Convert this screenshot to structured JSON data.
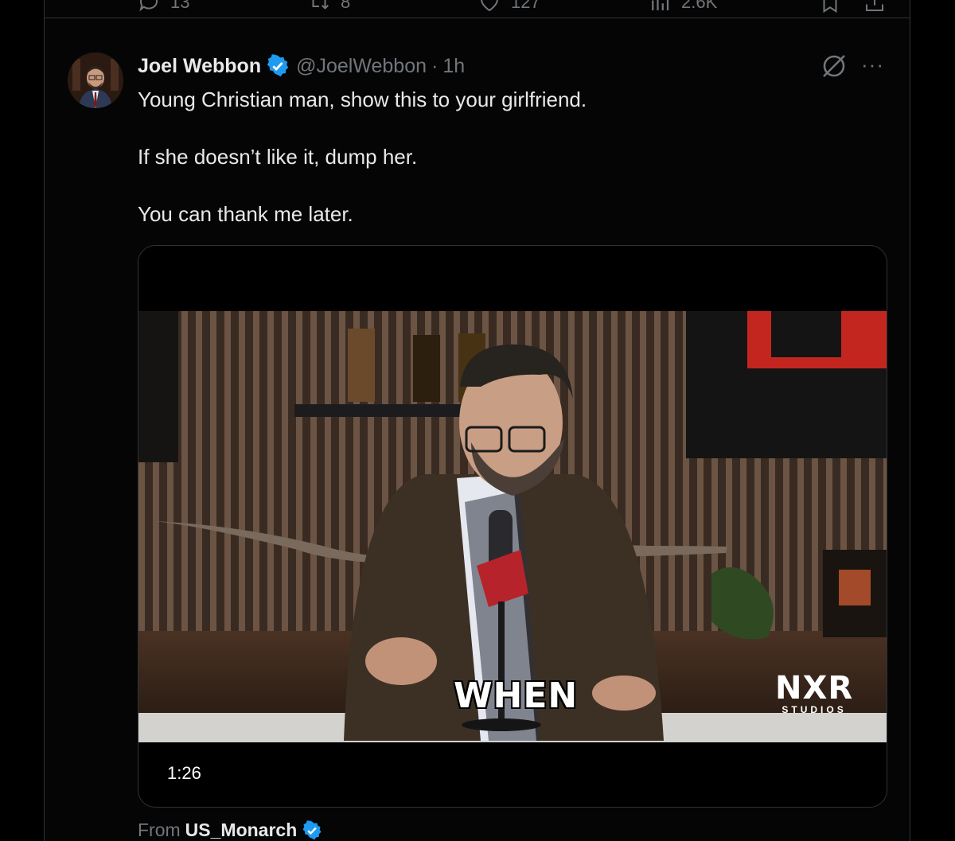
{
  "previous_tweet": {
    "replies": "13",
    "reposts": "8",
    "likes": "127",
    "views": "2.6K"
  },
  "tweet": {
    "author_name": "Joel Webbon",
    "handle": "@JoelWebbon",
    "time_sep": "·",
    "time": "1h",
    "more": "···",
    "lines": [
      "Young Christian man, show this to your girlfriend.",
      "If she doesn’t like it, dump her.",
      "You can thank me later."
    ]
  },
  "media": {
    "duration": "1:26",
    "caption": "WHEN",
    "brand_main": "NXR",
    "brand_sub": "STUDIOS"
  },
  "attribution": {
    "prefix": "From",
    "source": "US_Monarch"
  },
  "colors": {
    "verified": "#1d9bf0",
    "muted": "#71767b",
    "border": "#2f3336",
    "text": "#e7e9ea"
  },
  "icons": [
    "reply-icon",
    "repost-icon",
    "like-icon",
    "views-icon",
    "bookmark-icon",
    "share-icon",
    "verified-icon",
    "grok-icon",
    "more-icon"
  ]
}
